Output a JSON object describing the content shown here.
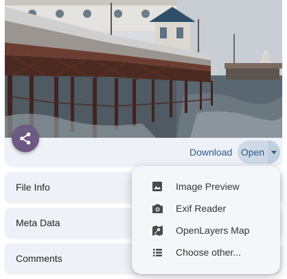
{
  "preview": {
    "image_alt": "Pier photo",
    "download_label": "Download",
    "open_label": "Open"
  },
  "sections": [
    {
      "label": "File Info"
    },
    {
      "label": "Meta Data"
    },
    {
      "label": "Comments"
    }
  ],
  "open_menu": {
    "items": [
      {
        "label": "Image Preview",
        "icon": "image-icon"
      },
      {
        "label": "Exif Reader",
        "icon": "camera-icon"
      },
      {
        "label": "OpenLayers Map",
        "icon": "map-icon"
      },
      {
        "label": "Choose other...",
        "icon": "list-icon"
      }
    ]
  },
  "colors": {
    "accent": "#2a5a87",
    "fab": "#6d5a83",
    "card_bg": "#eef2f8",
    "split_button_bg": "#cdd9e6"
  }
}
